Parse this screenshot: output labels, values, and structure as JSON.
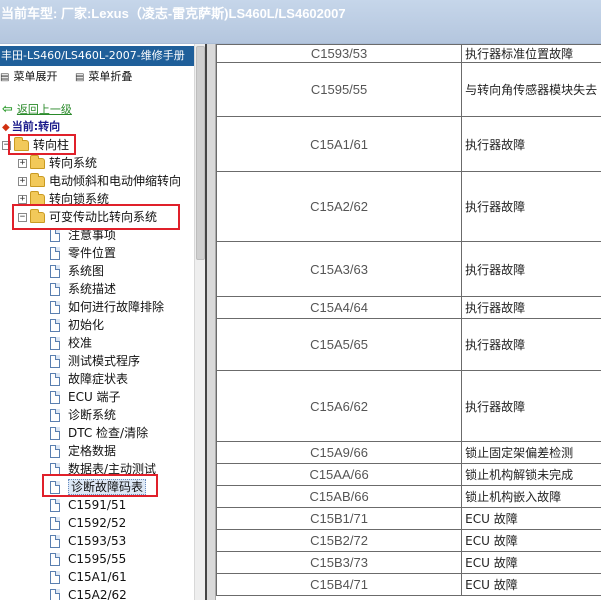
{
  "window": {
    "title": "当前车型:   厂家:Lexus（凌志-雷克萨斯)LS460L/LS4602007"
  },
  "sidebar": {
    "doc_title": "丰田-LS460/LS460L-2007-维修手册",
    "expand_all": "菜单展开",
    "collapse_all": "菜单折叠",
    "back_link": "返回上一级",
    "current_label": "当前:转向",
    "tree": {
      "root": "转向柱",
      "folders": [
        "转向系统",
        "电动倾斜和电动伸缩转向",
        "转向锁系统",
        "可变传动比转向系统"
      ],
      "pages": [
        "注意事项",
        "零件位置",
        "系统图",
        "系统描述",
        "如何进行故障排除",
        "初始化",
        "校准",
        "测试模式程序",
        "故障症状表",
        "ECU 端子",
        "诊断系统",
        "DTC 检查/清除",
        "定格数据",
        "数据表/主动测试",
        "诊断故障码表",
        "C1591/51",
        "C1592/52",
        "C1593/53",
        "C1595/55",
        "C15A1/61",
        "C15A2/62"
      ]
    }
  },
  "dtc_table": {
    "rows": [
      {
        "code": "C1593/53",
        "desc": "执行器标准位置故障"
      },
      {
        "code": "C1595/55",
        "desc": "与转向角传感器模块失去"
      },
      {
        "code": "C15A1/61",
        "desc": "执行器故障"
      },
      {
        "code": "C15A2/62",
        "desc": "执行器故障"
      },
      {
        "code": "C15A3/63",
        "desc": "执行器故障"
      },
      {
        "code": "C15A4/64",
        "desc": "执行器故障"
      },
      {
        "code": "C15A5/65",
        "desc": "执行器故障"
      },
      {
        "code": "C15A6/62",
        "desc": "执行器故障"
      },
      {
        "code": "C15A9/66",
        "desc": "锁止固定架偏差检测"
      },
      {
        "code": "C15AA/66",
        "desc": "锁止机构解锁未完成"
      },
      {
        "code": "C15AB/66",
        "desc": "锁止机构嵌入故障"
      },
      {
        "code": "C15B1/71",
        "desc": "ECU 故障"
      },
      {
        "code": "C15B2/72",
        "desc": "ECU 故障"
      },
      {
        "code": "C15B3/73",
        "desc": "ECU 故障"
      },
      {
        "code": "C15B4/71",
        "desc": "ECU 故障"
      }
    ]
  },
  "icons": {
    "folder": "folder-icon",
    "page": "document-icon",
    "back": "green-back-arrow-icon",
    "expand": "expand-icon",
    "collapse": "collapse-icon"
  },
  "colors": {
    "doc_title_bg": "#1f5f9a",
    "highlight_box": "#e0202a",
    "back_link": "#2a8a2a",
    "current_label": "#1a1a8a"
  }
}
